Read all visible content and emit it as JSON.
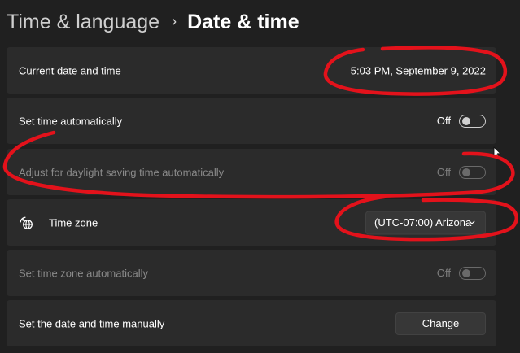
{
  "breadcrumb": {
    "parent": "Time & language",
    "separator": "›",
    "current": "Date & time"
  },
  "rows": {
    "current_datetime": {
      "label": "Current date and time",
      "value": "5:03 PM, September 9, 2022"
    },
    "set_time_auto": {
      "label": "Set time automatically",
      "state": "Off",
      "enabled": true,
      "on": false
    },
    "daylight_saving": {
      "label": "Adjust for daylight saving time automatically",
      "state": "Off",
      "enabled": false,
      "on": false
    },
    "time_zone": {
      "label": "Time zone",
      "icon": "globe-clock-icon",
      "value": "(UTC-07:00) Arizona"
    },
    "set_tz_auto": {
      "label": "Set time zone automatically",
      "state": "Off",
      "enabled": false,
      "on": false
    },
    "manual": {
      "label": "Set the date and time manually",
      "button": "Change"
    }
  },
  "colors": {
    "background": "#202020",
    "card": "#2b2b2b",
    "annotation": "#e3121b"
  }
}
